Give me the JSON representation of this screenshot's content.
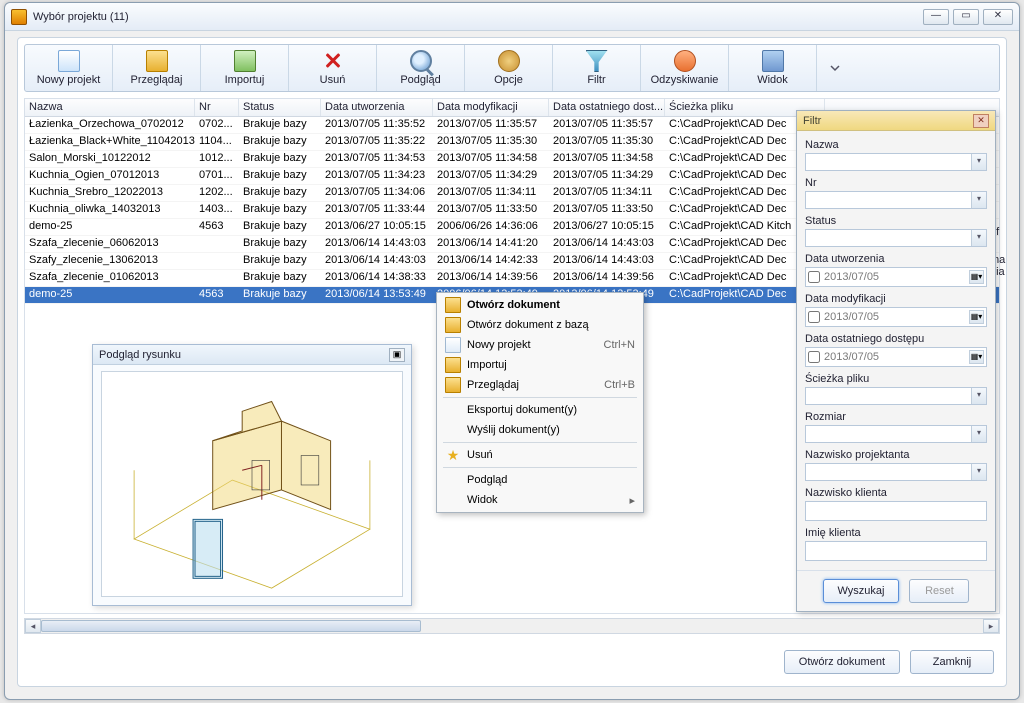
{
  "window": {
    "title": "Wybór projektu (11)"
  },
  "toolbar": {
    "new": "Nowy projekt",
    "browse": "Przeglądaj",
    "import": "Importuj",
    "delete": "Usuń",
    "preview": "Podgląd",
    "options": "Opcje",
    "filter": "Filtr",
    "recover": "Odzyskiwanie",
    "view": "Widok"
  },
  "columns": {
    "name": "Nazwa",
    "nr": "Nr",
    "status": "Status",
    "created": "Data utworzenia",
    "modified": "Data modyfikacji",
    "accessed": "Data ostatniego dost...",
    "path": "Ścieżka pliku"
  },
  "colw": {
    "name": 170,
    "nr": 44,
    "status": 82,
    "created": 112,
    "modified": 116,
    "accessed": 116,
    "path": 160
  },
  "rows": [
    {
      "name": "Łazienka_Orzechowa_0702012",
      "nr": "0702...",
      "status": "Brakuje bazy",
      "created": "2013/07/05 11:35:52",
      "modified": "2013/07/05 11:35:57",
      "accessed": "2013/07/05 11:35:57",
      "path": "C:\\CadProjekt\\CAD Dec"
    },
    {
      "name": "Łazienka_Black+White_11042013",
      "nr": "1104...",
      "status": "Brakuje bazy",
      "created": "2013/07/05 11:35:22",
      "modified": "2013/07/05 11:35:30",
      "accessed": "2013/07/05 11:35:30",
      "path": "C:\\CadProjekt\\CAD Dec"
    },
    {
      "name": "Salon_Morski_10122012",
      "nr": "1012...",
      "status": "Brakuje bazy",
      "created": "2013/07/05 11:34:53",
      "modified": "2013/07/05 11:34:58",
      "accessed": "2013/07/05 11:34:58",
      "path": "C:\\CadProjekt\\CAD Dec"
    },
    {
      "name": "Kuchnia_Ogien_07012013",
      "nr": "0701...",
      "status": "Brakuje bazy",
      "created": "2013/07/05 11:34:23",
      "modified": "2013/07/05 11:34:29",
      "accessed": "2013/07/05 11:34:29",
      "path": "C:\\CadProjekt\\CAD Dec"
    },
    {
      "name": "Kuchnia_Srebro_12022013",
      "nr": "1202...",
      "status": "Brakuje bazy",
      "created": "2013/07/05 11:34:06",
      "modified": "2013/07/05 11:34:11",
      "accessed": "2013/07/05 11:34:11",
      "path": "C:\\CadProjekt\\CAD Dec"
    },
    {
      "name": "Kuchnia_oliwka_14032013",
      "nr": "1403...",
      "status": "Brakuje bazy",
      "created": "2013/07/05 11:33:44",
      "modified": "2013/07/05 11:33:50",
      "accessed": "2013/07/05 11:33:50",
      "path": "C:\\CadProjekt\\CAD Dec"
    },
    {
      "name": "demo-25",
      "nr": "4563",
      "status": "Brakuje bazy",
      "created": "2013/06/27 10:05:15",
      "modified": "2006/06/26 14:36:06",
      "accessed": "2013/06/27 10:05:15",
      "path": "C:\\CadProjekt\\CAD Kitch"
    },
    {
      "name": "Szafa_zlecenie_06062013",
      "nr": "",
      "status": "Brakuje bazy",
      "created": "2013/06/14 14:43:03",
      "modified": "2013/06/14 14:41:20",
      "accessed": "2013/06/14 14:43:03",
      "path": "C:\\CadProjekt\\CAD Dec"
    },
    {
      "name": "Szafy_zlecenie_13062013",
      "nr": "",
      "status": "Brakuje bazy",
      "created": "2013/06/14 14:43:03",
      "modified": "2013/06/14 14:42:33",
      "accessed": "2013/06/14 14:43:03",
      "path": "C:\\CadProjekt\\CAD Dec"
    },
    {
      "name": "Szafa_zlecenie_01062013",
      "nr": "",
      "status": "Brakuje bazy",
      "created": "2013/06/14 14:38:33",
      "modified": "2013/06/14 14:39:56",
      "accessed": "2013/06/14 14:39:56",
      "path": "C:\\CadProjekt\\CAD Dec"
    },
    {
      "name": "demo-25",
      "nr": "4563",
      "status": "Brakuje bazy",
      "created": "2013/06/14 13:53:49",
      "modified": "2006/06/14 13:53:49",
      "accessed": "2013/06/14 13:53:49",
      "path": "C:\\CadProjekt\\CAD Dec",
      "selected": true
    }
  ],
  "preview": {
    "title": "Podgląd rysunku"
  },
  "ctx": {
    "open": "Otwórz dokument",
    "open_db": "Otwórz dokument z bazą",
    "new": "Nowy projekt",
    "new_sc": "Ctrl+N",
    "import": "Importuj",
    "browse": "Przeglądaj",
    "browse_sc": "Ctrl+B",
    "export": "Eksportuj dokument(y)",
    "send": "Wyślij dokument(y)",
    "delete": "Usuń",
    "preview": "Podgląd",
    "view": "Widok"
  },
  "filter": {
    "title": "Filtr",
    "name": "Nazwa",
    "nr": "Nr",
    "status": "Status",
    "created": "Data utworzenia",
    "modified": "Data modyfikacji",
    "accessed": "Data ostatniego dostępu",
    "date_value": "2013/07/05",
    "path": "Ścieżka pliku",
    "size": "Rozmiar",
    "designer": "Nazwisko projektanta",
    "client_last": "Nazwisko klienta",
    "client_first": "Imię klienta",
    "search": "Wyszukaj",
    "reset": "Reset"
  },
  "footer": {
    "open": "Otwórz dokument",
    "close": "Zamknij"
  },
  "bgtext": {
    "a": "of",
    "b": "ma",
    "c": "nia",
    "d": "ć"
  }
}
